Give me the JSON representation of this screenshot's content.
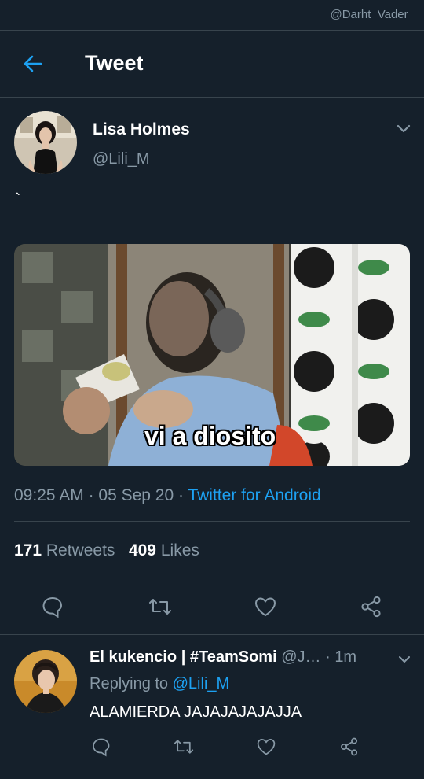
{
  "watermark": "@Darht_Vader_",
  "header": {
    "title": "Tweet",
    "back_icon": "arrow-left-icon"
  },
  "tweet": {
    "display_name": "Lisa Holmes",
    "handle": "@Lili_M",
    "text": "`",
    "media_caption": "vi a diosito",
    "time": "09:25 AM",
    "date": "05 Sep 20",
    "source": "Twitter for Android",
    "retweets_count": "171",
    "retweets_label": "Retweets",
    "likes_count": "409",
    "likes_label": "Likes",
    "actions": [
      "reply-icon",
      "retweet-icon",
      "like-icon",
      "share-icon"
    ]
  },
  "reply": {
    "display_name": "El kukencio | #TeamSomi",
    "handle": "@J…",
    "time": "1m",
    "replying_prefix": "Replying to",
    "replying_to": "@Lili_M",
    "text": "ALAMIERDA JAJAJAJAJAJJA"
  },
  "colors": {
    "background": "#15202b",
    "divider": "#38444d",
    "secondary_text": "#8899a6",
    "accent": "#1da1f2"
  }
}
